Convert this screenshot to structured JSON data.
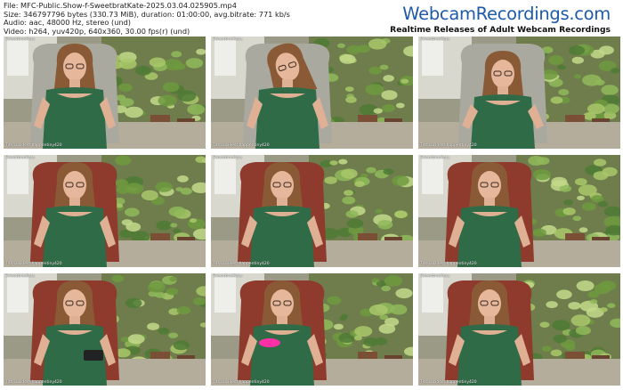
{
  "meta": {
    "file": "File: MFC-Public.Show-f-SweetbratKate-2025.03.04.025905.mp4",
    "size": "Size: 346797796 bytes (330.73 MiB), duration: 01:00:00, avg.bitrate: 771 kb/s",
    "audio": "Audio: aac, 48000 Hz, stereo (und)",
    "video": "Video: h264, yuv420p, 640x360, 30.00 fps(r) (und)"
  },
  "brand": {
    "name": "WebcamRecordings.com",
    "tagline": "Realtime Releases of Adult Webcam Recordings"
  },
  "overlay": {
    "username": "SweetbratKate",
    "goal_text": "Tits Lucidest happentiny420"
  },
  "colors": {
    "brand_blue": "#1e5aa8",
    "dress_green": "#2f6b46",
    "plants_green": "#7fa84e",
    "chair_gray": "#a9a9a0",
    "chair_red": "#8e3a2c",
    "pink_toy": "#ff2fa8"
  },
  "thumbnails": [
    {
      "variant": "chair-gray",
      "pose": "center"
    },
    {
      "variant": "chair-gray",
      "pose": "tilt"
    },
    {
      "variant": "chair-gray",
      "pose": "lean"
    },
    {
      "variant": "chair-red",
      "pose": "center"
    },
    {
      "variant": "chair-red",
      "pose": "center"
    },
    {
      "variant": "chair-red",
      "pose": "center"
    },
    {
      "variant": "chair-red",
      "pose": "phone"
    },
    {
      "variant": "chair-red",
      "pose": "toy"
    },
    {
      "variant": "chair-red",
      "pose": "center"
    }
  ]
}
